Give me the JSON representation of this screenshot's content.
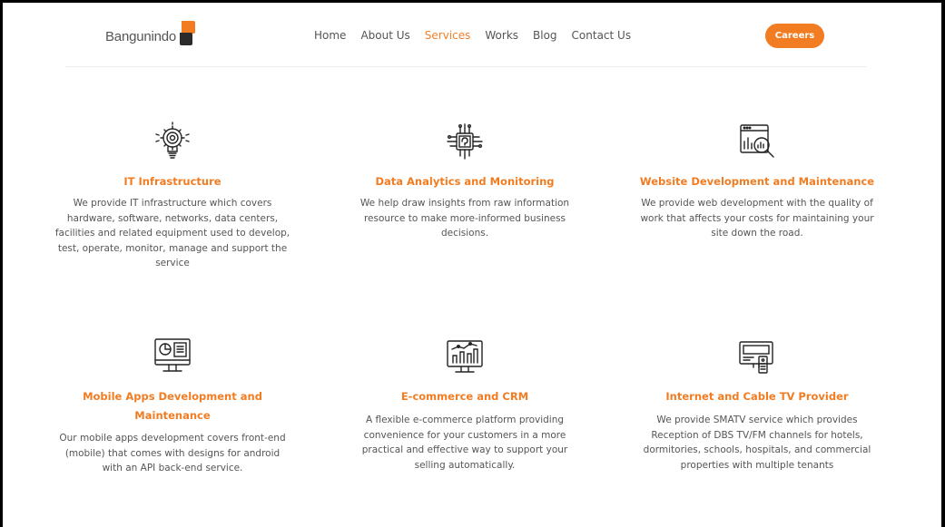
{
  "header": {
    "logo_text": "Bangunindo",
    "nav": [
      "Home",
      "About Us",
      "Services",
      "Works",
      "Blog",
      "Contact Us"
    ],
    "active_nav": "Services",
    "careers_label": "Careers",
    "accent_color": "#f27c22"
  },
  "services": [
    {
      "icon": "gear-bulb-icon",
      "title": "IT Infrastructure",
      "desc": "We provide IT infrastructure which covers hardware, software, networks, data centers, facilities and related equipment used to develop, test, operate, monitor, manage and support the service"
    },
    {
      "icon": "ai-chip-icon",
      "title": "Data Analytics and Monitoring",
      "desc": "We help draw insights from raw information resource to make more-informed business decisions."
    },
    {
      "icon": "web-analytics-icon",
      "title": "Website Development and Maintenance",
      "desc": "We provide web development with the quality of work that affects your costs for maintaining your site down the road."
    },
    {
      "icon": "monitor-dashboard-icon",
      "title": "Mobile Apps Development and Maintenance",
      "desc": "Our mobile apps development covers front-end (mobile) that comes with designs for android with an API back-end service."
    },
    {
      "icon": "ecommerce-chart-icon",
      "title": "E-commerce and CRM",
      "desc": "A flexible e-commerce platform providing convenience for your customers in a more practical and effective way to support your selling automatically."
    },
    {
      "icon": "tv-remote-icon",
      "title": "Internet and Cable TV Provider",
      "desc": "We provide SMATV service which provides Reception of DBS TV/FM channels for hotels, dormitories, schools, hospitals, and commercial properties with multiple tenants"
    }
  ]
}
